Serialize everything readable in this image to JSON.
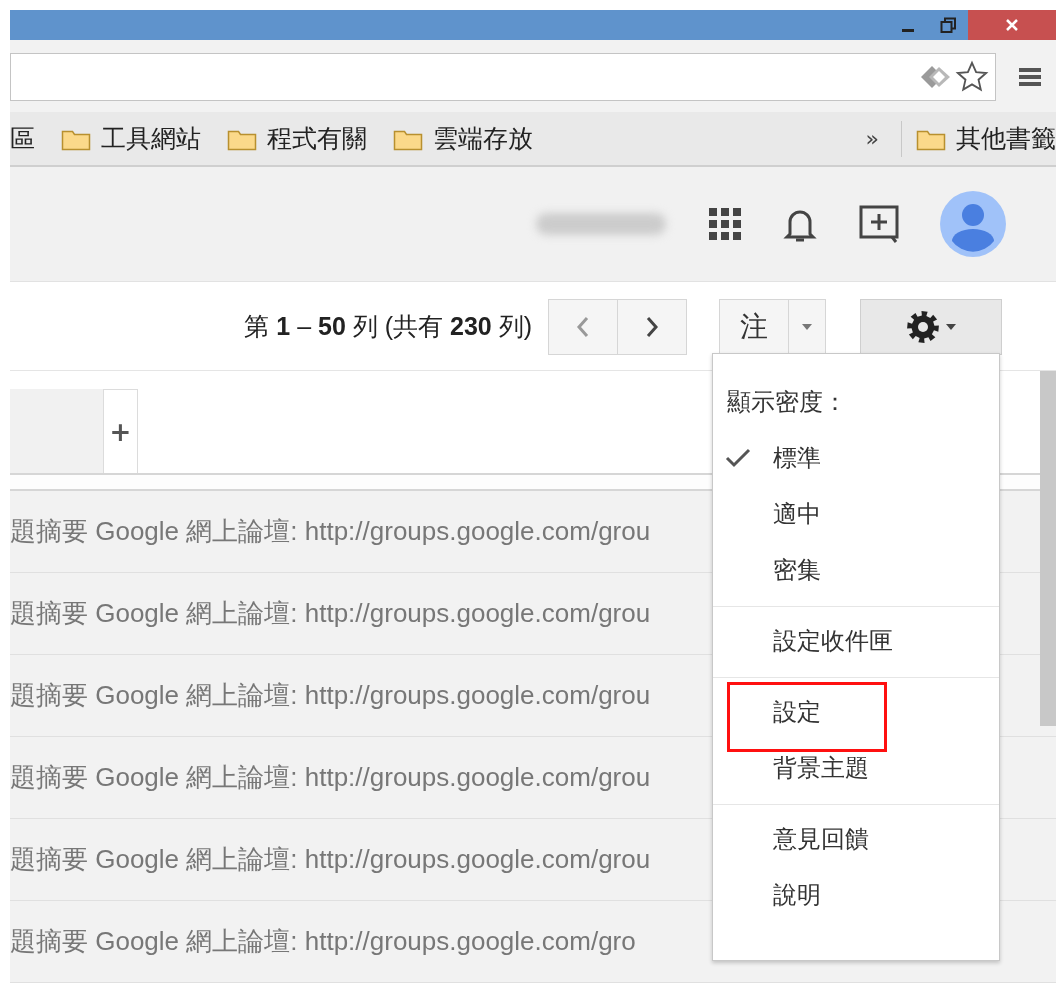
{
  "bookmarks": [
    {
      "label": "區",
      "folder": false
    },
    {
      "label": "工具網站",
      "folder": true
    },
    {
      "label": "程式有關",
      "folder": true
    },
    {
      "label": "雲端存放",
      "folder": true
    }
  ],
  "bookmarks_overflow": "»",
  "other_bookmarks": {
    "label": "其他書籤",
    "folder": true
  },
  "pagination": {
    "text": "第 **1** – **50** 列 (共有 **230** 列)"
  },
  "label_button": {
    "label": "注"
  },
  "tabs": [
    {
      "kind": "tab"
    },
    {
      "label": "+",
      "kind": "add"
    }
  ],
  "rows": [
    {
      "text": "題摘要 Google 網上論壇: http://groups.google.com/grou"
    },
    {
      "text": "題摘要 Google 網上論壇: http://groups.google.com/grou"
    },
    {
      "text": "題摘要 Google 網上論壇: http://groups.google.com/grou"
    },
    {
      "text": "題摘要 Google 網上論壇: http://groups.google.com/grou"
    },
    {
      "text": "題摘要 Google 網上論壇: http://groups.google.com/grou"
    },
    {
      "text": "題摘要 Google 網上論壇: http://groups.google.com/gro"
    }
  ],
  "menu": [
    [
      {
        "kind": "header",
        "label": "顯示密度："
      },
      {
        "kind": "option",
        "label": "標準",
        "checked": true
      },
      {
        "kind": "option",
        "label": "適中",
        "checked": false
      },
      {
        "kind": "option",
        "label": "密集",
        "checked": false
      }
    ],
    [
      {
        "kind": "action",
        "label": "設定收件匣",
        "highlighted": false
      }
    ],
    [
      {
        "kind": "action",
        "label": "設定",
        "highlighted": true
      },
      {
        "kind": "action",
        "label": "背景主題",
        "highlighted": false
      }
    ],
    [
      {
        "kind": "action",
        "label": "意見回饋",
        "highlighted": false
      },
      {
        "kind": "action",
        "label": "說明",
        "highlighted": false
      }
    ]
  ]
}
